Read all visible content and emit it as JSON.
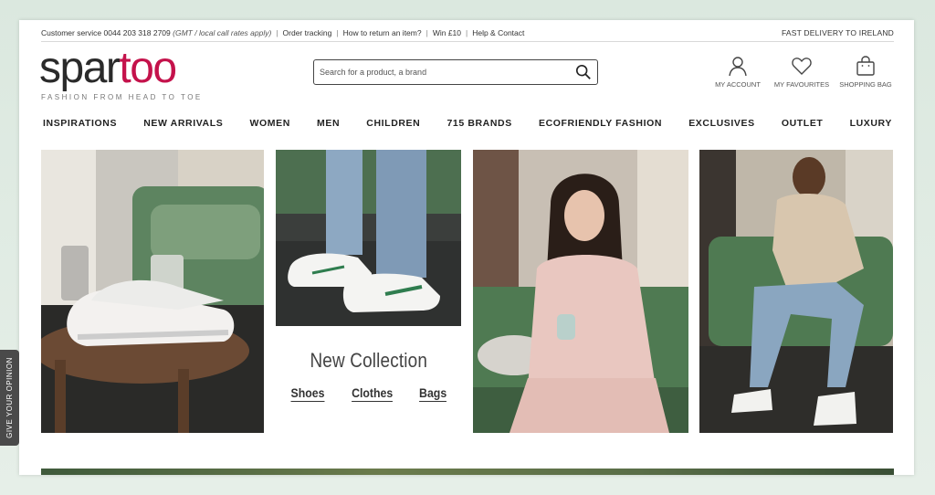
{
  "topbar": {
    "customer_service": "Customer service 0044 203 318 2709",
    "cs_note": "(GMT / local call rates apply)",
    "order_tracking": "Order tracking",
    "return": "How to return an item?",
    "win": "Win £10",
    "help": "Help & Contact",
    "delivery": "FAST DELIVERY TO IRELAND"
  },
  "logo": {
    "part1": "spar",
    "part2": "too",
    "tagline": "FASHION FROM HEAD TO TOE"
  },
  "search": {
    "placeholder": "Search for a product, a brand"
  },
  "header_icons": {
    "account": "MY ACCOUNT",
    "favourites": "MY FAVOURITES",
    "bag": "SHOPPING BAG"
  },
  "nav": [
    "INSPIRATIONS",
    "NEW ARRIVALS",
    "WOMEN",
    "MEN",
    "CHILDREN",
    "715 BRANDS",
    "ECOFRIENDLY FASHION",
    "EXCLUSIVES",
    "OUTLET",
    "LUXURY"
  ],
  "collection": {
    "title": "New Collection",
    "shoes": "Shoes",
    "clothes": "Clothes",
    "bags": "Bags"
  },
  "feedback_tab": "GIVE YOUR OPINION",
  "colors": {
    "brand": "#c4124b",
    "sofa_green": "#4f7a52"
  }
}
